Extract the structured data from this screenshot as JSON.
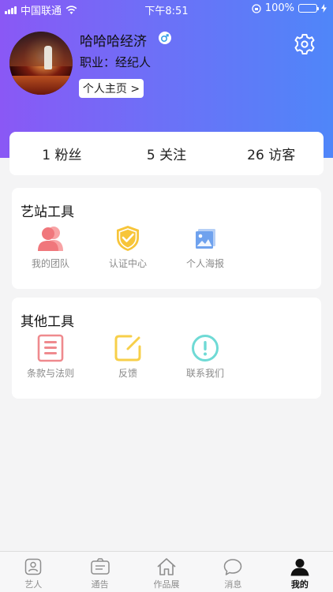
{
  "status_bar": {
    "carrier": "中国联通",
    "time": "下午8:51",
    "battery": "100%"
  },
  "profile": {
    "name": "哈哈哈经济",
    "job": "职业：经纪人",
    "homepage_button": "个人主页 >"
  },
  "stats": [
    {
      "label": "1 粉丝"
    },
    {
      "label": "5 关注"
    },
    {
      "label": "26 访客"
    }
  ],
  "station_tools": {
    "title": "艺站工具",
    "items": [
      {
        "label": "我的团队",
        "icon": "team-icon"
      },
      {
        "label": "认证中心",
        "icon": "shield-check-icon"
      },
      {
        "label": "个人海报",
        "icon": "poster-icon"
      }
    ]
  },
  "other_tools": {
    "title": "其他工具",
    "items": [
      {
        "label": "条款与法则",
        "icon": "document-icon"
      },
      {
        "label": "反馈",
        "icon": "edit-icon"
      },
      {
        "label": "联系我们",
        "icon": "info-exclamation-icon"
      }
    ]
  },
  "tabbar": {
    "items": [
      {
        "label": "艺人",
        "icon": "artist-card-icon"
      },
      {
        "label": "通告",
        "icon": "notice-icon"
      },
      {
        "label": "作品展",
        "icon": "home-icon"
      },
      {
        "label": "消息",
        "icon": "chat-bubble-icon"
      },
      {
        "label": "我的",
        "icon": "user-icon"
      }
    ],
    "active_index": 4
  },
  "colors": {
    "header_gradient_start": "#8a58f5",
    "header_gradient_end": "#4f86f9",
    "team_icon": "#f0777c",
    "shield_icon": "#f7c53a",
    "poster_icon": "#6fa2ee",
    "document_icon": "#ef8a8e",
    "edit_icon": "#f7cf4a",
    "contact_icon": "#6fdad5"
  }
}
